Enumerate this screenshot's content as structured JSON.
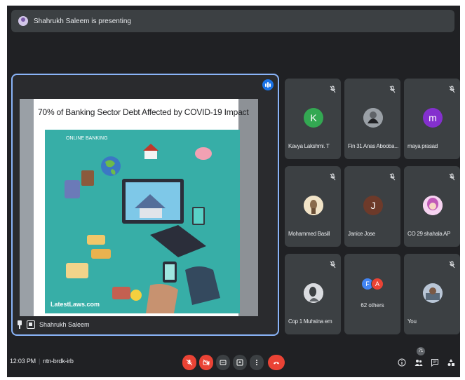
{
  "banner": {
    "text": "Shahrukh Saleem is presenting",
    "icon": "presenter-avatar-icon"
  },
  "main": {
    "slide_title": "70% of Banking Sector Debt Affected by COVID-19 Impact",
    "slide_logo": "LatestLaws.com",
    "slide_tag": "ONLINE BANKING",
    "presenter_name": "Shahrukh Saleem"
  },
  "participants": [
    {
      "name": "Kavya Lakshmi. T",
      "initial": "K",
      "color": "#33a852",
      "muted": true
    },
    {
      "name": "Fin 31 Anas Abooba...",
      "initial": "",
      "color": "#5f6368",
      "muted": true
    },
    {
      "name": "maya prasad",
      "initial": "m",
      "color": "#8430ce",
      "muted": true
    },
    {
      "name": "Mohammed Basill",
      "initial": "",
      "color": "#8a6b4c",
      "muted": true
    },
    {
      "name": "Janice Jose",
      "initial": "J",
      "color": "#6d3a2a",
      "muted": true
    },
    {
      "name": "CO 29 shahala AP",
      "initial": "",
      "color": "#e07bd0",
      "muted": true
    },
    {
      "name": "Cop 1 Muhsina em",
      "initial": "",
      "color": "#e8eaed",
      "muted": true
    },
    {
      "name": "You",
      "initial": "",
      "color": "#6b7a8f",
      "muted": true
    }
  ],
  "others": {
    "label": "62 others",
    "avatars": [
      "F",
      "A"
    ],
    "colors": [
      "#4285f4",
      "#ea4335"
    ]
  },
  "bottom": {
    "time": "12:03 PM",
    "meeting_code": "ntn-brdk-irb",
    "participant_count": "71",
    "colors": {
      "danger": "#ea4335",
      "control": "#3c4043",
      "accent": "#8ab4f8"
    }
  }
}
